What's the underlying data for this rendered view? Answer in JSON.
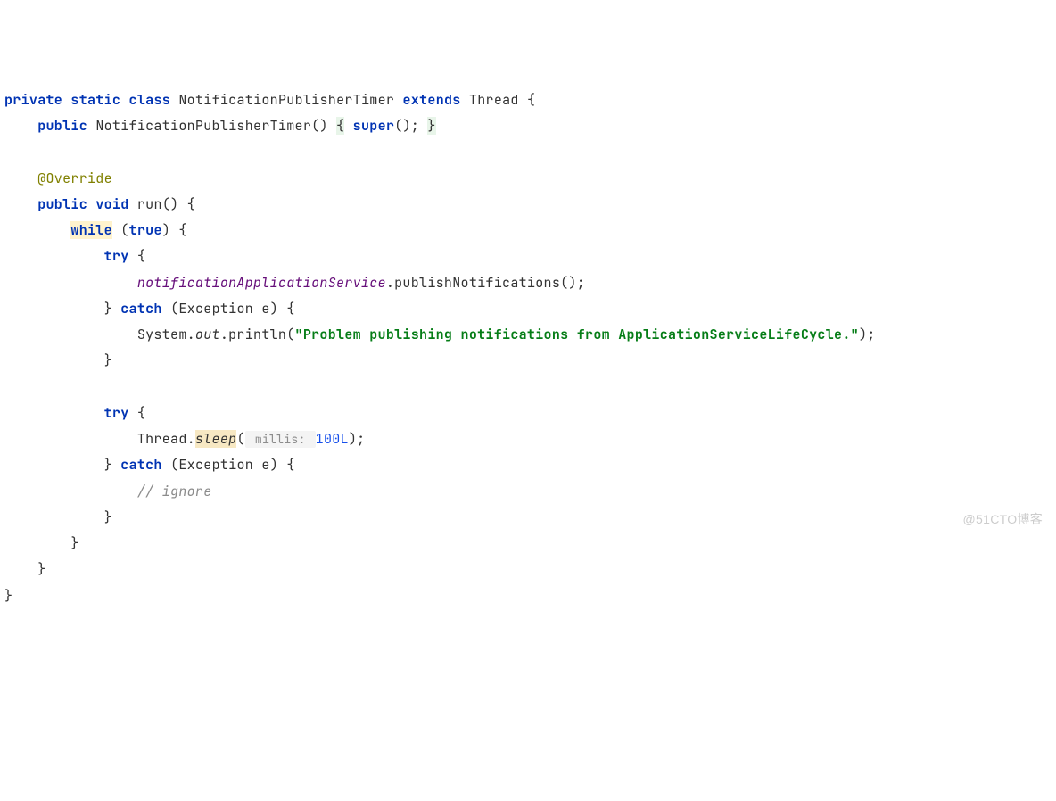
{
  "code": {
    "line1": {
      "private": "private",
      "static": "static",
      "class_kw": "class",
      "class_name": "NotificationPublisherTimer",
      "extends": "extends",
      "parent": "Thread",
      "brace": "{"
    },
    "line2": {
      "public": "public",
      "ctor": "NotificationPublisherTimer()",
      "brace_open": "{",
      "super_kw": "super",
      "super_call": "();",
      "brace_close": "}"
    },
    "line4": {
      "annotation": "@Override"
    },
    "line5": {
      "public": "public",
      "void": "void",
      "method": "run()",
      "brace": "{"
    },
    "line6": {
      "while": "while",
      "true": "true",
      "paren_open": "(",
      "paren_close": ")",
      "brace": "{"
    },
    "line7": {
      "try": "try",
      "brace": "{"
    },
    "line8": {
      "field": "notificationApplicationService",
      "method": ".publishNotifications();"
    },
    "line9": {
      "brace": "}",
      "catch": "catch",
      "paren_open": "(",
      "exception": "Exception e",
      "paren_close": ")",
      "brace2": "{"
    },
    "line10": {
      "system": "System.",
      "out": "out",
      "println": ".println(",
      "string": "\"Problem publishing notifications from ApplicationServiceLifeCycle.\"",
      "close": ");"
    },
    "line11": {
      "brace": "}"
    },
    "line13": {
      "try": "try",
      "brace": "{"
    },
    "line14": {
      "thread": "Thread.",
      "sleep": "sleep",
      "paren": "(",
      "hint": " millis: ",
      "value": "100L",
      "close": ");"
    },
    "line15": {
      "brace": "}",
      "catch": "catch",
      "paren_open": "(",
      "exception": "Exception e",
      "paren_close": ")",
      "brace2": "{"
    },
    "line16": {
      "comment": "// ignore"
    },
    "line17": {
      "brace": "}"
    },
    "line18": {
      "brace": "}"
    },
    "line19": {
      "brace": "}"
    },
    "line20": {
      "brace": "}"
    }
  },
  "watermark": "@51CTO博客"
}
